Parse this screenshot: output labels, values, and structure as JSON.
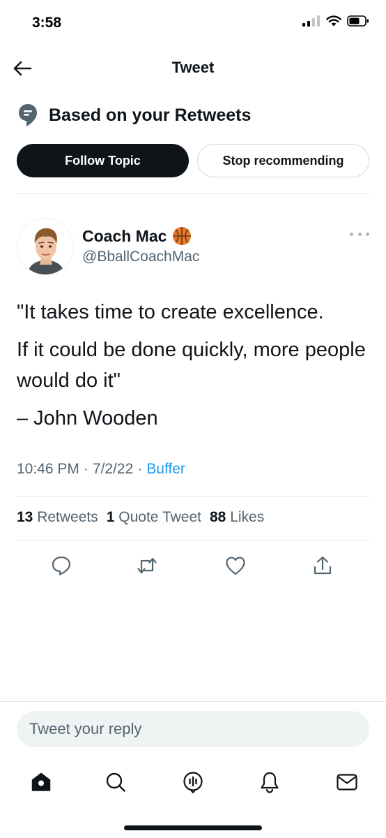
{
  "status_bar": {
    "time": "3:58"
  },
  "nav": {
    "title": "Tweet",
    "back_icon": "arrow-left-icon"
  },
  "topic": {
    "label": "Based on your Retweets",
    "icon": "topic-icon",
    "follow_label": "Follow Topic",
    "stop_label": "Stop recommending"
  },
  "tweet": {
    "author_name": "Coach Mac",
    "author_emoji": "basketball-icon",
    "handle": "@BballCoachMac",
    "lines": [
      "\"It takes time to create excellence.",
      "If it could be done quickly, more people would do it\"",
      "– John Wooden"
    ],
    "time": "10:46 PM",
    "date": "7/2/22",
    "source": "Buffer",
    "separator": "·"
  },
  "stats": {
    "retweets_count": "13",
    "retweets_label": "Retweets",
    "quotes_count": "1",
    "quotes_label": "Quote Tweet",
    "likes_count": "88",
    "likes_label": "Likes"
  },
  "reply": {
    "placeholder": "Tweet your reply"
  },
  "colors": {
    "accent": "#1d9bf0",
    "text": "#0f1419",
    "secondary": "#536471",
    "divider": "#e1e8ed",
    "reply_bg": "#eff3f4"
  }
}
